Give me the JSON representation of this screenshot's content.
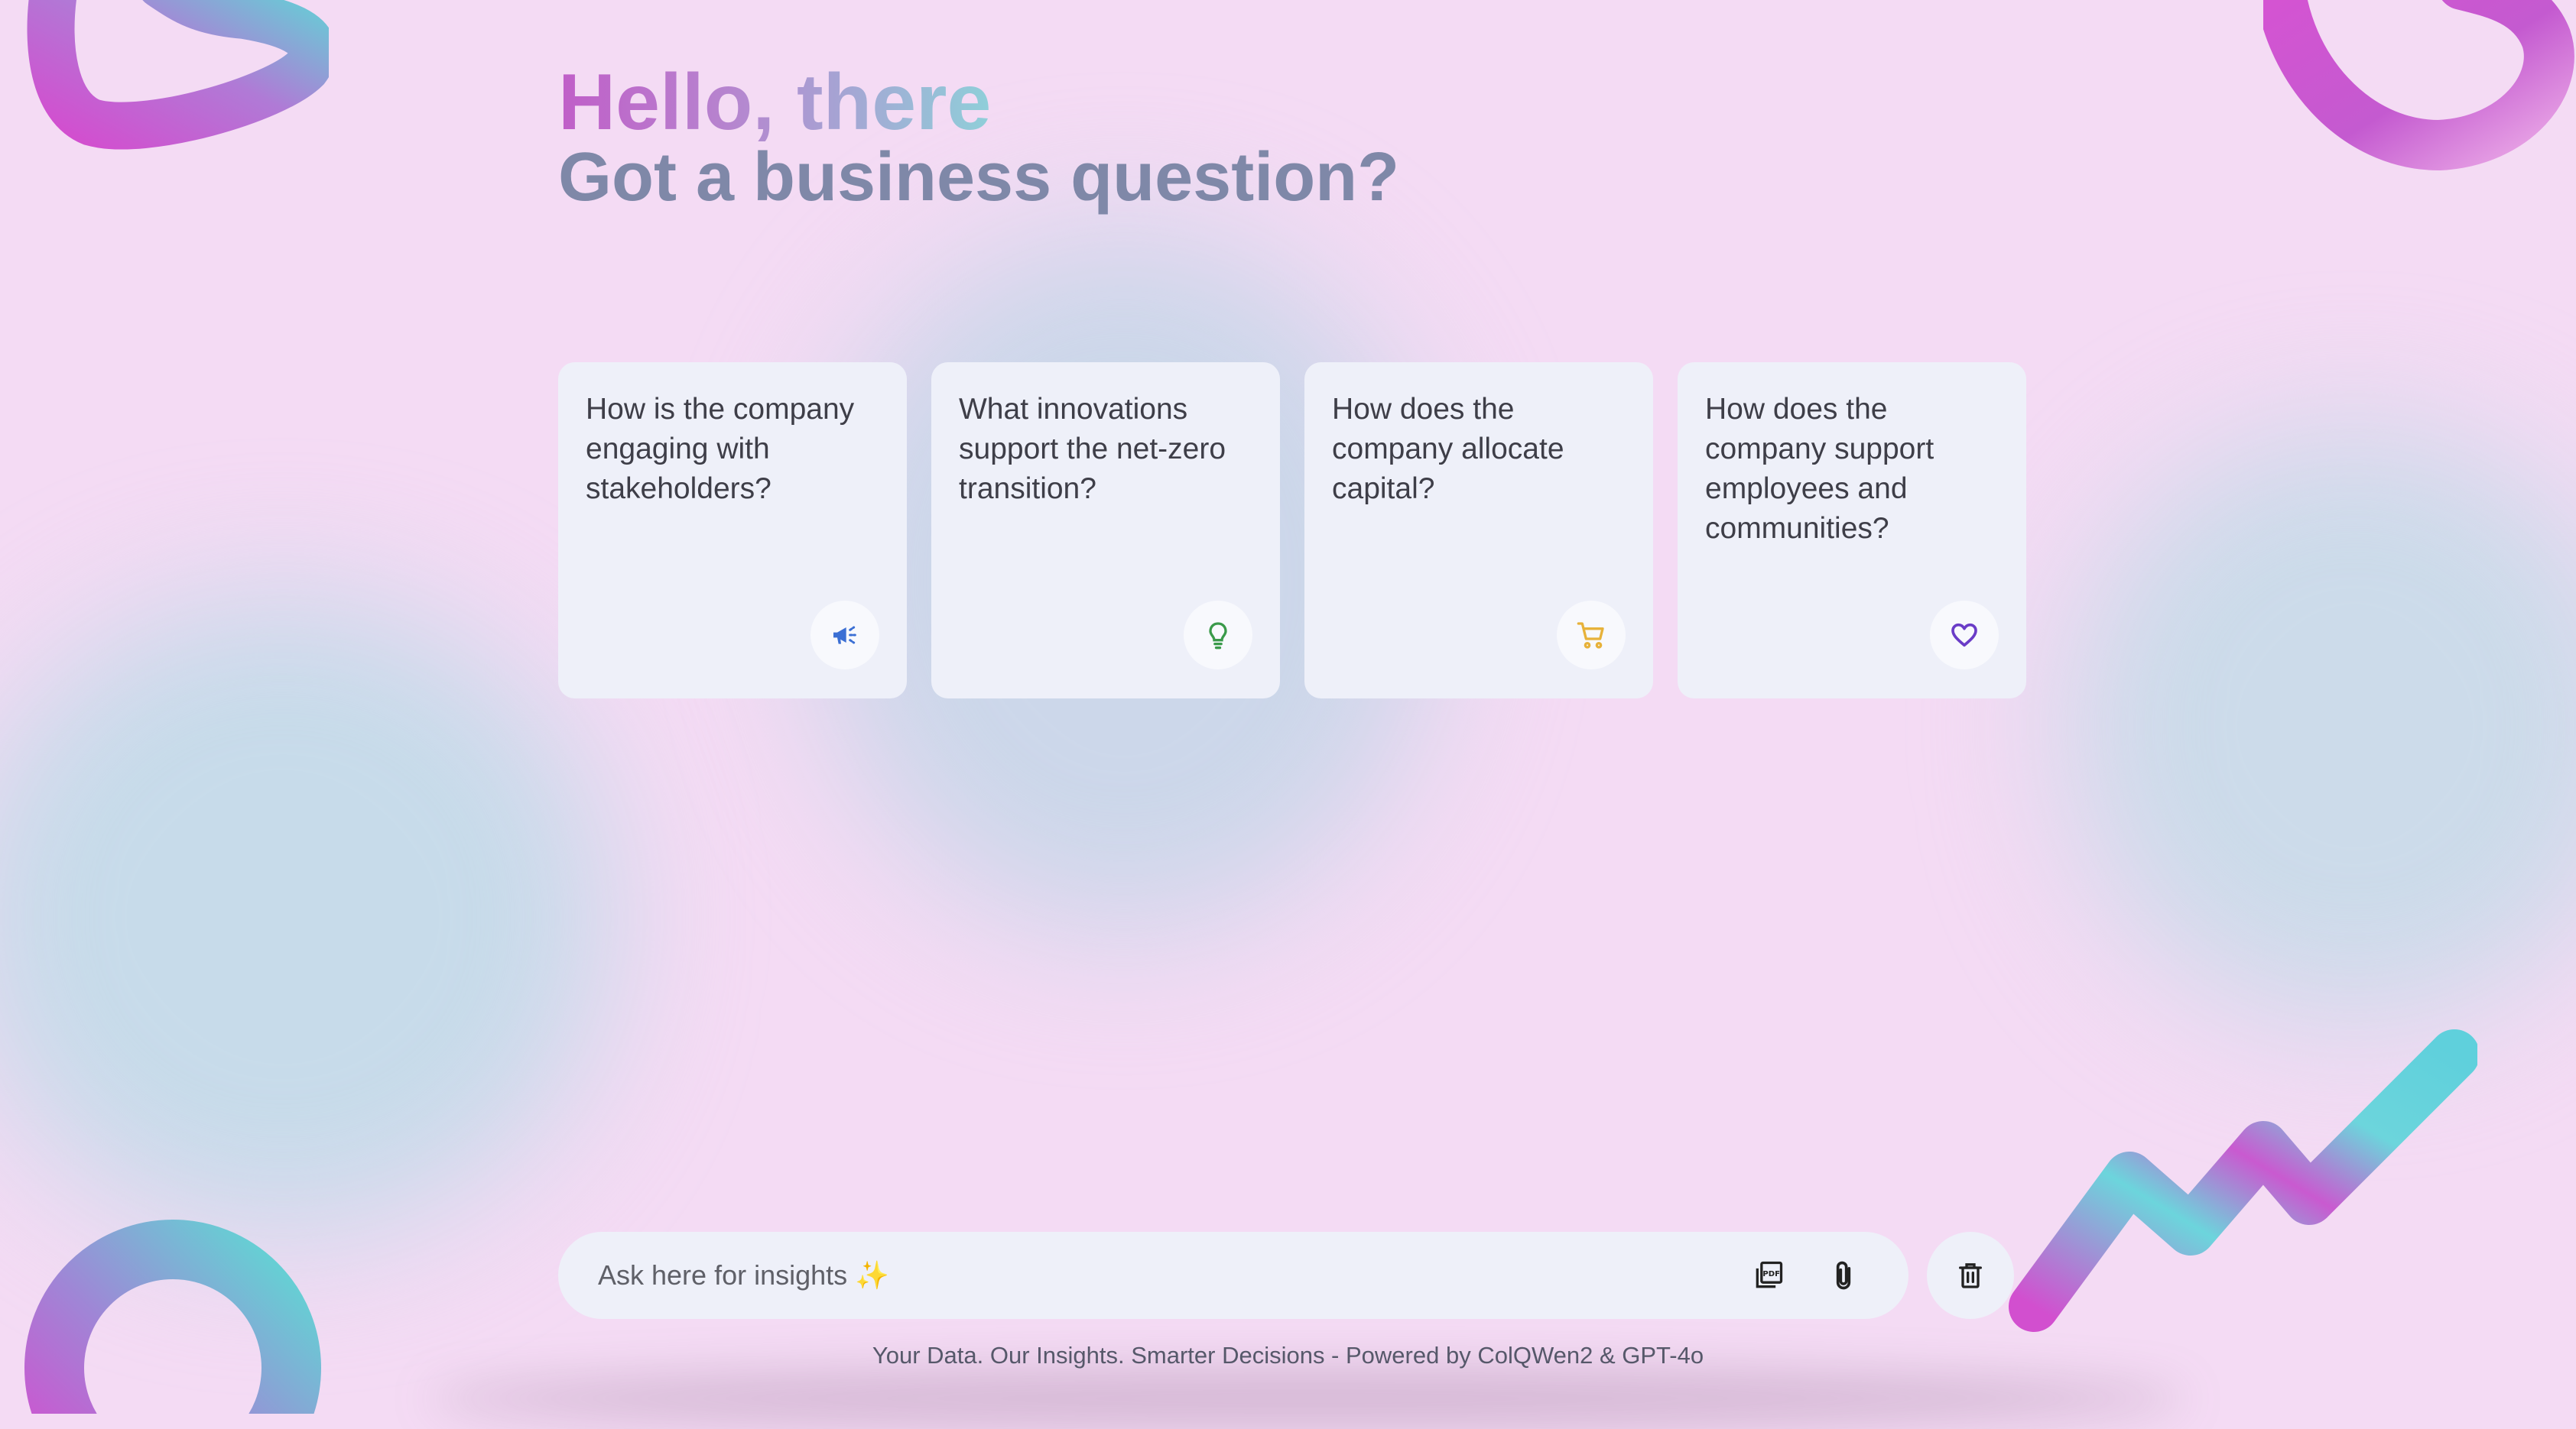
{
  "greeting": {
    "hello": "Hello, there",
    "subtitle": "Got a business question?"
  },
  "cards": [
    {
      "text": "How is the company engaging with stakeholders?",
      "icon": "megaphone-icon",
      "icon_color": "#3b6fd4"
    },
    {
      "text": "What innovations support the net-zero transition?",
      "icon": "lightbulb-icon",
      "icon_color": "#3a9a4a"
    },
    {
      "text": "How does the company allocate capital?",
      "icon": "cart-icon",
      "icon_color": "#e7b23a"
    },
    {
      "text": "How does the company support employees and communities?",
      "icon": "heart-icon",
      "icon_color": "#6a3cc7"
    }
  ],
  "input": {
    "placeholder": "Ask here for insights ✨",
    "value": ""
  },
  "actions": {
    "pdf_icon": "pdf-icon",
    "attach_icon": "paperclip-icon",
    "delete_icon": "trash-icon"
  },
  "footer": {
    "text": "Your Data. Our Insights. Smarter Decisions - Powered by ColQWen2 & GPT-4o"
  },
  "colors": {
    "background": "#f4dbf4",
    "card_bg": "#eef0f9",
    "hello_gradient_start": "#c05ec8",
    "hello_gradient_end": "#8fcfd9",
    "subtitle": "#7f88a8"
  }
}
